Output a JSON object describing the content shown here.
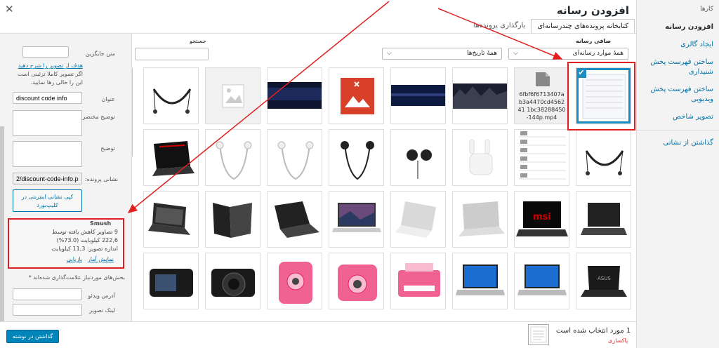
{
  "modal": {
    "title": "افزودن رسانه",
    "close_icon": "close-icon"
  },
  "menu": {
    "header": "کارها",
    "items": [
      {
        "label": "افزودن رسانه",
        "active": true
      },
      {
        "label": "ایجاد گالری",
        "active": false
      },
      {
        "label": "ساختن فهرست پخش شنیداری",
        "active": false
      },
      {
        "label": "ساختن فهرست پخش ویدیویی",
        "active": false
      },
      {
        "label": "تصویر شاخص",
        "active": false
      }
    ],
    "footer_item": "گذاشتن از نشانی"
  },
  "tabs": [
    {
      "label": "بارگذاری پرونده‌ها",
      "active": false
    },
    {
      "label": "کتابخانه پرونده‌های چندرسانه‌ای",
      "active": true
    }
  ],
  "filters": {
    "label": "صافی رسانه",
    "type_select": "همهٔ موارد رسانه‌ای",
    "date_select": "همهٔ تاریخ‌ها",
    "search_label": "جستجو",
    "search_value": ""
  },
  "grid": {
    "items": [
      {
        "kind": "selected-doc"
      },
      {
        "kind": "file",
        "text": "6fbf6f6713407ab3a4470cd456241 1bc38288450-144p.mp4"
      },
      {
        "kind": "mountains"
      },
      {
        "kind": "pattern"
      },
      {
        "kind": "broken-image"
      },
      {
        "kind": "dark-banner"
      },
      {
        "kind": "placeholder"
      },
      {
        "kind": "neckband"
      },
      {
        "kind": "neckband"
      },
      {
        "kind": "specs-chart"
      },
      {
        "kind": "earpods-case"
      },
      {
        "kind": "earbuds-black"
      },
      {
        "kind": "earphones-black"
      },
      {
        "kind": "earphones-white"
      },
      {
        "kind": "earphones-white"
      },
      {
        "kind": "laptop-gaming"
      },
      {
        "kind": "laptop-black"
      },
      {
        "kind": "laptop-msi"
      },
      {
        "kind": "laptop-silver"
      },
      {
        "kind": "laptop-mac-silver"
      },
      {
        "kind": "laptop-mac-desktop"
      },
      {
        "kind": "laptop-black-open"
      },
      {
        "kind": "laptop-black-side"
      },
      {
        "kind": "laptop-workstation"
      },
      {
        "kind": "laptop-asus"
      },
      {
        "kind": "laptop-windows"
      },
      {
        "kind": "laptop-windows"
      },
      {
        "kind": "printer-pink"
      },
      {
        "kind": "instax-pink"
      },
      {
        "kind": "instax-pink-front"
      },
      {
        "kind": "dslr-front"
      },
      {
        "kind": "dslr-back"
      }
    ]
  },
  "sidebar": {
    "alt_label": "متن جایگزین",
    "alt_value": "",
    "alt_note_link": "هدف از تصویر را شرح دهید",
    "alt_note_rest": "اگر تصویر کاملا تزئینی است این را خالی رها نمایید.",
    "title_label": "عنوان",
    "title_value": "discount code info",
    "caption_label": "توضیح مختصر",
    "desc_label": "توضیح",
    "url_label": "نشانی پرونده:",
    "url_value": "2/discount-code-info.png",
    "copy_button": "کپی نشانی اینترنتی در کلیپ‌بورد",
    "smush": {
      "title": "Smush",
      "line1": "9 تصاویر کاهش یافته توسط",
      "line2": "222,6 کیلوبایت (73.0%)",
      "line3": "اندازه تصویر: 11,3 کیلوبایت",
      "restore": "بازیابی",
      "stats": "نمایش آمار"
    },
    "required_note": "بخش‌های موردنیاز علامت‌گذاری شده‌اند *",
    "video_label": "آدرس ویدئو",
    "image_link_label": "لینک تصویر"
  },
  "footer": {
    "selected_count": "1 مورد انتخاب شده است",
    "clear": "پاکسازی",
    "insert_button": "گذاشتن در نوشته"
  },
  "colors": {
    "accent": "#0073aa",
    "primary_button": "#0085ba",
    "annotation": "#e02020"
  }
}
